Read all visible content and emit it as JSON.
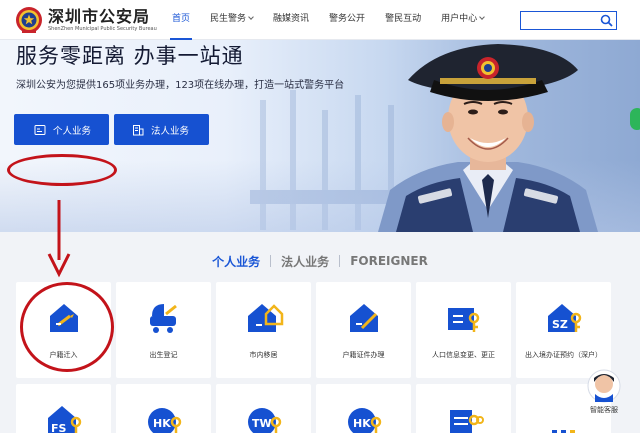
{
  "header": {
    "logo_cn": "深圳市公安局",
    "logo_en": "ShenZhen Municipal Public Security Bureau",
    "nav": [
      {
        "label": "首页",
        "active": true,
        "has_caret": false
      },
      {
        "label": "民生警务",
        "active": false,
        "has_caret": true
      },
      {
        "label": "融媒资讯",
        "active": false,
        "has_caret": false
      },
      {
        "label": "警务公开",
        "active": false,
        "has_caret": false
      },
      {
        "label": "警民互动",
        "active": false,
        "has_caret": false
      },
      {
        "label": "用户中心",
        "active": false,
        "has_caret": true
      }
    ],
    "search": {
      "value": "",
      "placeholder": "",
      "icon": "search-icon"
    }
  },
  "banner": {
    "title": "服务零距离 办事一站通",
    "subtitle": "深圳公安为您提供165项业务办理，123项在线办理，打造一站式警务平台",
    "btn_personal": "个人业务",
    "btn_corporate": "法人业务"
  },
  "tabs": [
    {
      "label": "个人业务",
      "active": true
    },
    {
      "label": "法人业务",
      "active": false
    },
    {
      "label": "FOREIGNER",
      "active": false
    }
  ],
  "cards_row1": [
    {
      "label": "户籍迁入",
      "icon": "house-pen-icon"
    },
    {
      "label": "出生登记",
      "icon": "stroller-icon"
    },
    {
      "label": "市内移居",
      "icon": "house-move-icon"
    },
    {
      "label": "户籍证件办理",
      "icon": "house-document-icon"
    },
    {
      "label": "人口信息变更、更正",
      "icon": "id-card-edit-icon"
    },
    {
      "label": "出入境办证预约（深户）",
      "icon": "sz-permit-icon"
    }
  ],
  "cards_row2": [
    {
      "label": "",
      "icon": "fs-permit-icon"
    },
    {
      "label": "",
      "icon": "hk-permit-icon"
    },
    {
      "label": "",
      "icon": "tw-permit-icon"
    },
    {
      "label": "",
      "icon": "hk-permit-icon"
    },
    {
      "label": "",
      "icon": "document-icon"
    },
    {
      "label": "",
      "icon": "more-icon"
    }
  ],
  "assistant": {
    "label": "智能客服"
  },
  "colors": {
    "brand_blue": "#1a56d6",
    "accent_yellow": "#f2b51a",
    "annotation_red": "#c3131a"
  }
}
